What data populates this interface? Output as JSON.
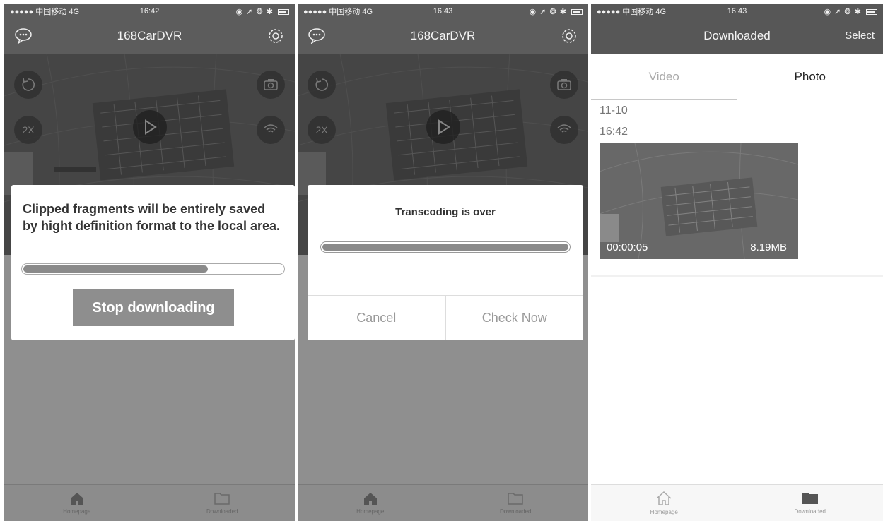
{
  "screens": [
    {
      "status": {
        "carrier": "●●●●● 中国移动 4G",
        "time": "16:42"
      },
      "title": "168CarDVR",
      "camera_buttons": {
        "zoom": "2X"
      },
      "dialog": {
        "message": "Clipped fragments will be entirely saved by hight definition format to the local area.",
        "progress_fraction": 0.71,
        "stop_label": "Stop downloading"
      },
      "tabs": [
        {
          "label": "Homepage"
        },
        {
          "label": "Downloaded"
        }
      ]
    },
    {
      "status": {
        "carrier": "●●●●● 中国移动 4G",
        "time": "16:43"
      },
      "title": "168CarDVR",
      "camera_buttons": {
        "zoom": "2X"
      },
      "dialog": {
        "message": "Transcoding is over",
        "progress_fraction": 1.0,
        "cancel_label": "Cancel",
        "check_label": "Check Now"
      },
      "tabs": [
        {
          "label": "Homepage"
        },
        {
          "label": "Downloaded"
        }
      ]
    },
    {
      "status": {
        "carrier": "●●●●● 中国移动 4G",
        "time": "16:43"
      },
      "title": "Downloaded",
      "select_label": "Select",
      "segments": [
        "Video",
        "Photo"
      ],
      "date": "11-10",
      "time": "16:42",
      "clip": {
        "duration": "00:00:05",
        "size": "8.19MB"
      },
      "tabs": [
        {
          "label": "Homepage"
        },
        {
          "label": "Downloaded"
        }
      ]
    }
  ]
}
